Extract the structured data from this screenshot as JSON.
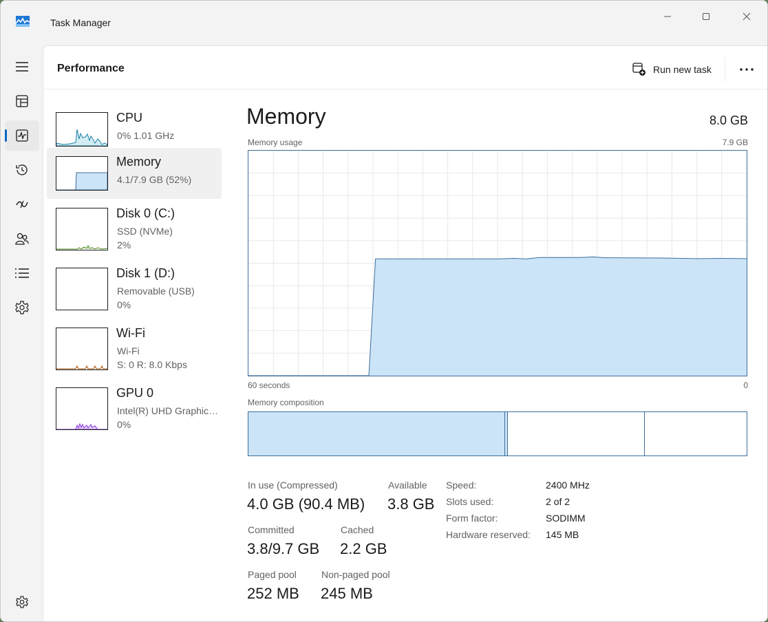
{
  "window": {
    "title": "Task Manager"
  },
  "header": {
    "page_title": "Performance",
    "run_new_task": "Run new task"
  },
  "nav": {
    "items": [
      {
        "name": "hamburger-menu-icon"
      },
      {
        "name": "processes-icon"
      },
      {
        "name": "performance-icon",
        "active": true
      },
      {
        "name": "app-history-icon"
      },
      {
        "name": "startup-apps-icon"
      },
      {
        "name": "users-icon"
      },
      {
        "name": "details-icon"
      },
      {
        "name": "services-icon"
      },
      {
        "name": "settings-gear-icon"
      }
    ]
  },
  "resources": [
    {
      "name": "CPU",
      "line1": "0%  1.01 GHz",
      "line2": "",
      "selected": false,
      "color": "#1a83a6"
    },
    {
      "name": "Memory",
      "line1": "4.1/7.9 GB (52%)",
      "line2": "",
      "selected": true,
      "color": "#3c6d9b"
    },
    {
      "name": "Disk 0 (C:)",
      "line1": "SSD (NVMe)",
      "line2": "2%",
      "selected": false,
      "color": "#4d8c1f"
    },
    {
      "name": "Disk 1 (D:)",
      "line1": "Removable (USB)",
      "line2": "0%",
      "selected": false,
      "color": "#4d8c1f"
    },
    {
      "name": "Wi-Fi",
      "line1": "Wi-Fi",
      "line2": "S: 0 R: 8.0 Kbps",
      "selected": false,
      "color": "#a74f01"
    },
    {
      "name": "GPU 0",
      "line1": "Intel(R) UHD Graphic…",
      "line2": "0%",
      "selected": false,
      "color": "#8a2be2"
    }
  ],
  "memory": {
    "title": "Memory",
    "total": "8.0 GB",
    "usage_label": "Memory usage",
    "usage_max": "7.9 GB",
    "time_left": "60 seconds",
    "time_right": "0",
    "composition_label": "Memory composition",
    "composition": {
      "in_use": 0.515,
      "modified": 0.006,
      "standby": 0.275,
      "free": 0.204
    },
    "stats": {
      "in_use_label": "In use (Compressed)",
      "in_use_value": "4.0 GB (90.4 MB)",
      "available_label": "Available",
      "available_value": "3.8 GB",
      "committed_label": "Committed",
      "committed_value": "3.8/9.7 GB",
      "cached_label": "Cached",
      "cached_value": "2.2 GB",
      "paged_label": "Paged pool",
      "paged_value": "252 MB",
      "nonpaged_label": "Non-paged pool",
      "nonpaged_value": "245 MB"
    },
    "specs": [
      {
        "label": "Speed:",
        "value": "2400 MHz"
      },
      {
        "label": "Slots used:",
        "value": "2 of 2"
      },
      {
        "label": "Form factor:",
        "value": "SODIMM"
      },
      {
        "label": "Hardware reserved:",
        "value": "145 MB"
      }
    ]
  },
  "chart_data": {
    "type": "area",
    "x_range": [
      60,
      0
    ],
    "ylim": [
      0,
      7.9
    ],
    "series": [
      {
        "values": [
          [
            60,
            0
          ],
          [
            45.5,
            0
          ],
          [
            44.7,
            4.1
          ],
          [
            30,
            4.1
          ],
          [
            28,
            4.12
          ],
          [
            26.5,
            4.1
          ],
          [
            25,
            4.15
          ],
          [
            20,
            4.15
          ],
          [
            18.5,
            4.17
          ],
          [
            17,
            4.14
          ],
          [
            10,
            4.13
          ],
          [
            6,
            4.11
          ],
          [
            3,
            4.12
          ],
          [
            0,
            4.11
          ]
        ]
      }
    ],
    "grid": true,
    "fill": "#cce4f7",
    "line": "#3c6d9b"
  },
  "colors": {
    "accent": "#0067c0",
    "memory_line": "#3c6d9b",
    "memory_fill": "#cce4f7"
  }
}
